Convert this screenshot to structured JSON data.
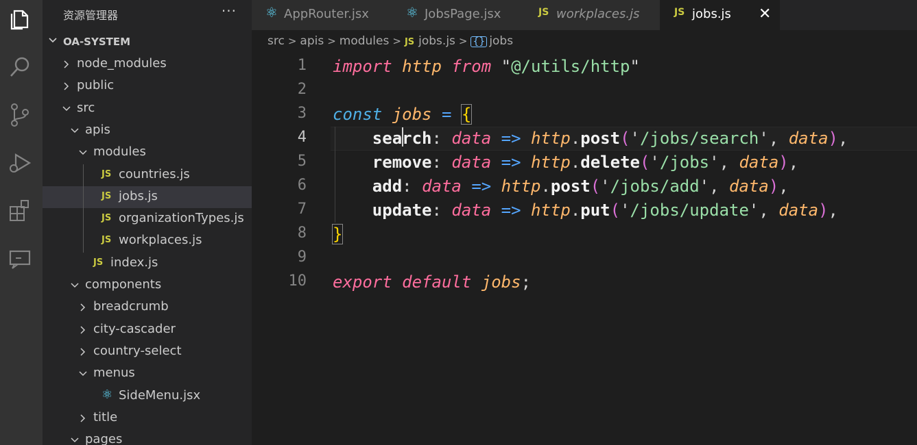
{
  "sidebar": {
    "title": "资源管理器",
    "more": "···",
    "section": "OA-SYSTEM",
    "tree": [
      {
        "label": "node_modules",
        "type": "folder",
        "open": false,
        "depth": 0
      },
      {
        "label": "public",
        "type": "folder",
        "open": false,
        "depth": 0
      },
      {
        "label": "src",
        "type": "folder",
        "open": true,
        "depth": 0
      },
      {
        "label": "apis",
        "type": "folder",
        "open": true,
        "depth": 1
      },
      {
        "label": "modules",
        "type": "folder",
        "open": true,
        "depth": 2
      },
      {
        "label": "countries.js",
        "type": "js",
        "depth": 3
      },
      {
        "label": "jobs.js",
        "type": "js",
        "depth": 3,
        "selected": true
      },
      {
        "label": "organizationTypes.js",
        "type": "js",
        "depth": 3
      },
      {
        "label": "workplaces.js",
        "type": "js",
        "depth": 3
      },
      {
        "label": "index.js",
        "type": "js",
        "depth": 2
      },
      {
        "label": "components",
        "type": "folder",
        "open": true,
        "depth": 1
      },
      {
        "label": "breadcrumb",
        "type": "folder",
        "open": false,
        "depth": 2
      },
      {
        "label": "city-cascader",
        "type": "folder",
        "open": false,
        "depth": 2
      },
      {
        "label": "country-select",
        "type": "folder",
        "open": false,
        "depth": 2
      },
      {
        "label": "menus",
        "type": "folder",
        "open": true,
        "depth": 2
      },
      {
        "label": "SideMenu.jsx",
        "type": "react",
        "depth": 3
      },
      {
        "label": "title",
        "type": "folder",
        "open": false,
        "depth": 2
      },
      {
        "label": "pages",
        "type": "folder",
        "open": true,
        "depth": 1
      }
    ]
  },
  "tabs": [
    {
      "label": "AppRouter.jsx",
      "icon": "react-icon",
      "icon_text": "⚛"
    },
    {
      "label": "JobsPage.jsx",
      "icon": "react-icon",
      "icon_text": "⚛"
    },
    {
      "label": "workplaces.js",
      "icon": "js-icon",
      "icon_text": "JS",
      "italic": true
    },
    {
      "label": "jobs.js",
      "icon": "js-icon",
      "icon_text": "JS",
      "active": true,
      "close": "✕"
    }
  ],
  "breadcrumb": {
    "parts": [
      "src",
      "apis",
      "modules",
      "jobs.js",
      "jobs"
    ],
    "js_badge": "JS",
    "symbol_badge": "{}"
  },
  "editor": {
    "line_numbers": [
      "1",
      "2",
      "3",
      "4",
      "5",
      "6",
      "7",
      "8",
      "9",
      "10"
    ],
    "current_line": 4
  },
  "colors": {
    "background": "#1e1e1e",
    "sidebar": "#252526",
    "activity_bar": "#333333",
    "js_badge": "#cbcb41",
    "react_icon": "#61dafb"
  }
}
